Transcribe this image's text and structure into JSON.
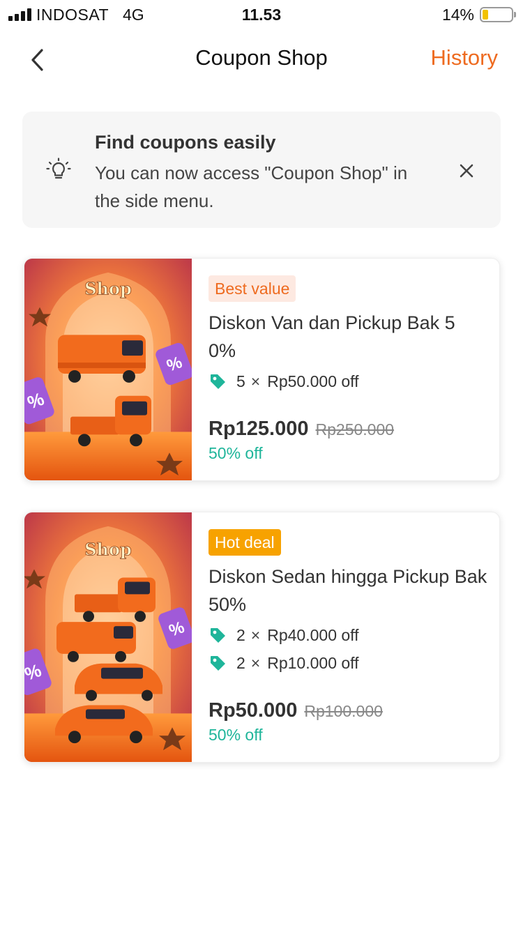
{
  "status_bar": {
    "carrier": "INDOSAT",
    "network": "4G",
    "time": "11.53",
    "battery_percent": "14%",
    "battery_level": 0.14
  },
  "nav": {
    "back_icon": "chevron-left-icon",
    "title": "Coupon Shop",
    "history_label": "History"
  },
  "tip": {
    "icon": "lightbulb-icon",
    "title": "Find coupons easily",
    "text": "You can now access \"Coupon Shop\" in the side menu.",
    "close_icon": "close-icon"
  },
  "coupons": [
    {
      "badge": "Best value",
      "title": "Diskon Van dan Pickup Bak 5 0%",
      "items": [
        {
          "count": "5",
          "times": "×",
          "value": "Rp50.000 off"
        }
      ],
      "price": "Rp125.000",
      "original_price": "Rp250.000",
      "discount": "50% off",
      "image_text": "Shop"
    },
    {
      "badge": "Hot deal",
      "title": "Diskon Sedan hingga Pickup Bak 50%",
      "items": [
        {
          "count": "2",
          "times": "×",
          "value": "Rp40.000 off"
        },
        {
          "count": "2",
          "times": "×",
          "value": "Rp10.000 off"
        }
      ],
      "price": "Rp50.000",
      "original_price": "Rp100.000",
      "discount": "50% off",
      "image_text": "Shop"
    }
  ],
  "colors": {
    "accent": "#ee6b20",
    "discount_green": "#1fb59a",
    "hot_badge": "#f7a200",
    "tag_icon": "#1fb59a"
  }
}
